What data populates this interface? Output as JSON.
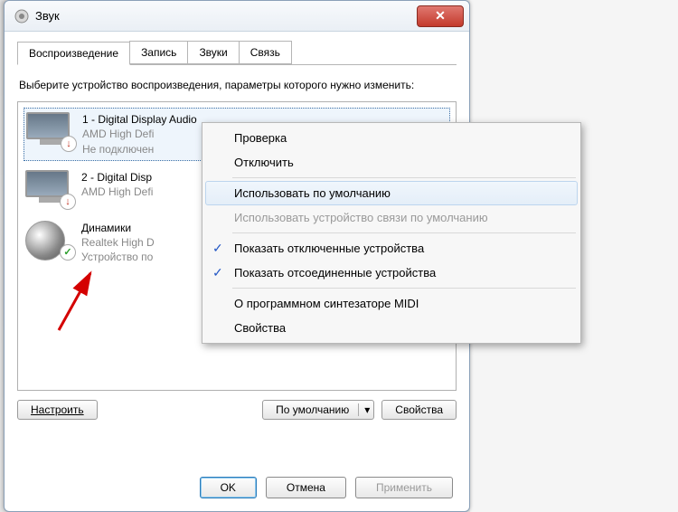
{
  "window": {
    "title": "Звук"
  },
  "tabs": [
    {
      "label": "Воспроизведение",
      "active": true
    },
    {
      "label": "Запись",
      "active": false
    },
    {
      "label": "Звуки",
      "active": false
    },
    {
      "label": "Связь",
      "active": false
    }
  ],
  "prompt": "Выберите устройство воспроизведения, параметры которого нужно изменить:",
  "devices": [
    {
      "name": "1 - Digital Display Audio",
      "sub1": "AMD High Defi",
      "sub2": "Не подключен",
      "status": "down",
      "selected": true,
      "icon": "monitor"
    },
    {
      "name": "2 - Digital Disp",
      "sub1": "AMD High Defi",
      "sub2": "",
      "status": "down",
      "selected": false,
      "icon": "monitor"
    },
    {
      "name": "Динамики",
      "sub1": "Realtek High D",
      "sub2": "Устройство по",
      "status": "ok",
      "selected": false,
      "icon": "speaker"
    }
  ],
  "lower": {
    "configure": "Настроить",
    "default": "По умолчанию",
    "properties": "Свойства"
  },
  "dialog": {
    "ok": "OK",
    "cancel": "Отмена",
    "apply": "Применить"
  },
  "context_menu": [
    {
      "label": "Проверка",
      "type": "item"
    },
    {
      "label": "Отключить",
      "type": "item"
    },
    {
      "type": "sep"
    },
    {
      "label": "Использовать по умолчанию",
      "type": "item",
      "highlight": true
    },
    {
      "label": "Использовать устройство связи по умолчанию",
      "type": "item",
      "disabled": true
    },
    {
      "type": "sep"
    },
    {
      "label": "Показать отключенные устройства",
      "type": "item",
      "checked": true
    },
    {
      "label": "Показать отсоединенные устройства",
      "type": "item",
      "checked": true
    },
    {
      "type": "sep"
    },
    {
      "label": "О программном синтезаторе MIDI",
      "type": "item"
    },
    {
      "label": "Свойства",
      "type": "item"
    }
  ]
}
